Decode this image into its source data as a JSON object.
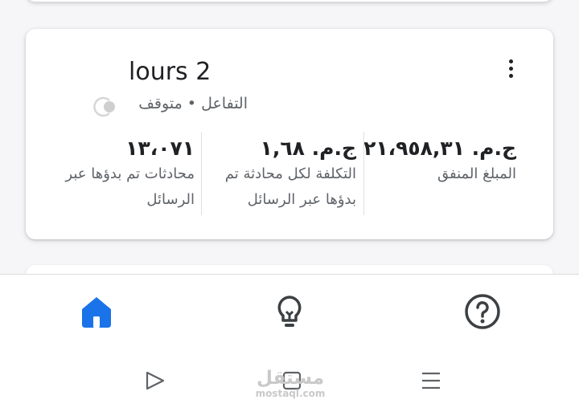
{
  "campaign_card": {
    "name": "lours 2",
    "status_label": "التفاعل",
    "status_separator": "•",
    "status_value": "متوقف",
    "metrics": [
      {
        "value": "ج.م. ٢١،٩٥٨,٣١",
        "label": "المبلغ المنفق"
      },
      {
        "value": "ج.م. ١,٦٨",
        "label": "التكلفة لكل محادثة تم بدؤها عبر الرسائل"
      },
      {
        "value": "١٣،٠٧١",
        "label": "محادثات تم بدؤها عبر الرسائل"
      }
    ]
  },
  "bottom_nav": {
    "active_color": "#1a73e8",
    "items": [
      {
        "icon": "home-icon",
        "active": true
      },
      {
        "icon": "lightbulb-icon",
        "active": false
      },
      {
        "icon": "help-icon",
        "active": false
      }
    ]
  },
  "system_nav": {
    "items": [
      {
        "icon": "back-triangle-icon"
      },
      {
        "icon": "home-square-icon"
      },
      {
        "icon": "menu-lines-icon"
      }
    ]
  },
  "watermark": {
    "arabic": "مستقل",
    "latin": "mostaql.com"
  }
}
